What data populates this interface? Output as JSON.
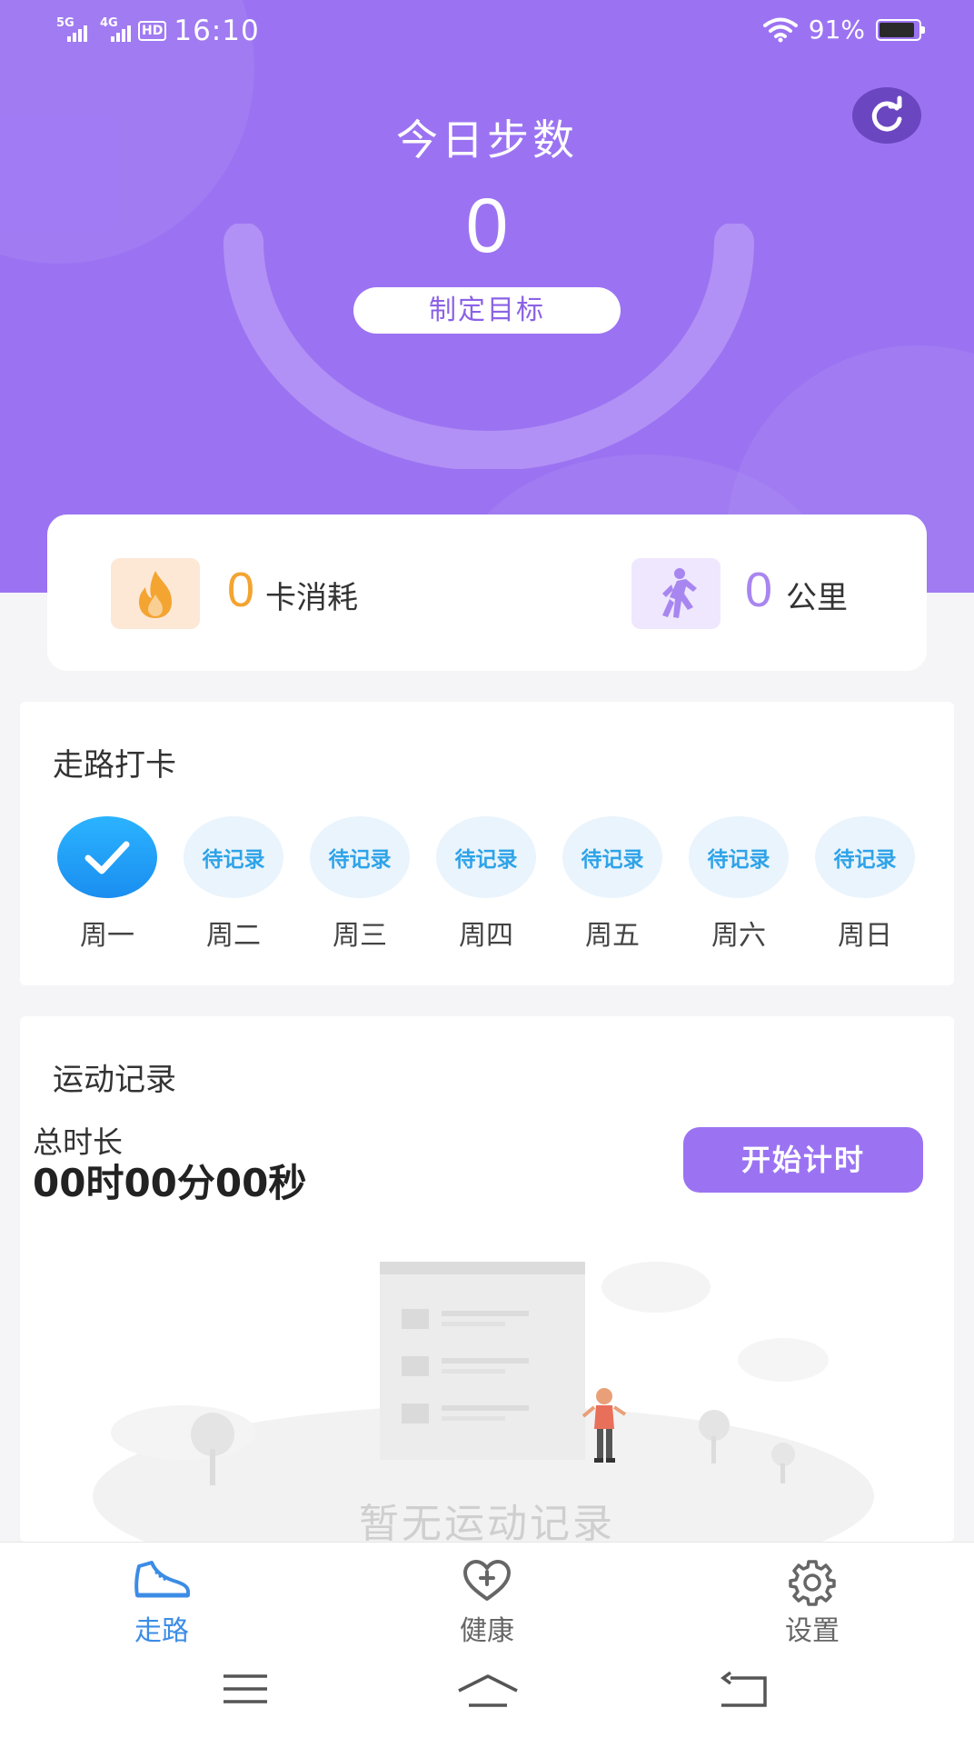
{
  "status_bar": {
    "network1": "5G",
    "network2": "4G",
    "hd": "HD",
    "time": "16:10",
    "battery": "91%"
  },
  "header": {
    "title": "今日步数",
    "steps": "0",
    "goal_button": "制定目标",
    "refresh_icon": "refresh-icon"
  },
  "stats": {
    "calories_value": "0",
    "calories_label": "卡消耗",
    "distance_value": "0",
    "distance_label": "公里"
  },
  "checkin": {
    "title": "走路打卡",
    "days": [
      {
        "label": "周一",
        "status": "done",
        "text": ""
      },
      {
        "label": "周二",
        "status": "pending",
        "text": "待记录"
      },
      {
        "label": "周三",
        "status": "pending",
        "text": "待记录"
      },
      {
        "label": "周四",
        "status": "pending",
        "text": "待记录"
      },
      {
        "label": "周五",
        "status": "pending",
        "text": "待记录"
      },
      {
        "label": "周六",
        "status": "pending",
        "text": "待记录"
      },
      {
        "label": "周日",
        "status": "pending",
        "text": "待记录"
      }
    ]
  },
  "record": {
    "title": "运动记录",
    "total_label": "总时长",
    "total_value": "00时00分00秒",
    "start_button": "开始计时",
    "empty_text": "暂无运动记录"
  },
  "tabs": [
    {
      "label": "走路",
      "icon": "shoe-icon",
      "active": true
    },
    {
      "label": "健康",
      "icon": "heart-plus-icon",
      "active": false
    },
    {
      "label": "设置",
      "icon": "gear-icon",
      "active": false
    }
  ],
  "colors": {
    "primary": "#9b73f2",
    "active_tab": "#3c8ce6",
    "calorie": "#f3a431",
    "distance": "#a886f0",
    "pending_day": "#2ea3e8"
  }
}
